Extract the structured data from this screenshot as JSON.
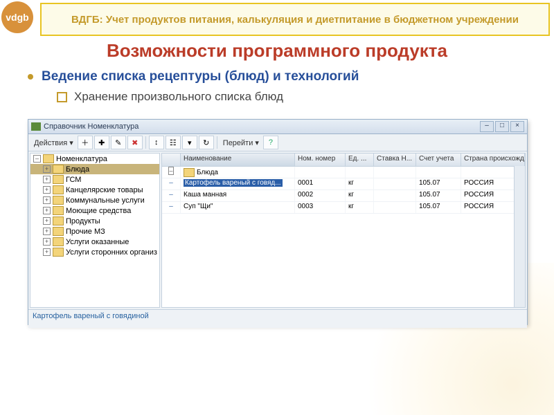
{
  "logo": "vdgb",
  "header": "ВДГБ: Учет продуктов питания, калькуляция и диетпитание в бюджетном учреждении",
  "title": "Возможности программного продукта",
  "bullet1": "Ведение списка рецептуры (блюд) и технологий",
  "bullet2": "Хранение произвольного списка блюд",
  "window": {
    "title": "Справочник Номенклатура",
    "actions": "Действия ▾",
    "goto": "Перейти ▾",
    "tree": {
      "root": "Номенклатура",
      "items": [
        "Блюда",
        "ГСМ",
        "Канцелярские товары",
        "Коммунальные услуги",
        "Моющие средства",
        "Продукты",
        "Прочие МЗ",
        "Услуги оказанные",
        "Услуги сторонних организ"
      ]
    },
    "columns": [
      "",
      "Наименование",
      "Ном. номер",
      "Ед. ...",
      "Ставка Н...",
      "Счет учета",
      "Страна происхождения"
    ],
    "rows": [
      {
        "folder": true,
        "name": "Блюда"
      },
      {
        "name": "Картофель вареный с говяд...",
        "num": "0001",
        "unit": "кг",
        "acct": "105.07",
        "country": "РОССИЯ",
        "selected": true
      },
      {
        "name": "Каша манная",
        "num": "0002",
        "unit": "кг",
        "acct": "105.07",
        "country": "РОССИЯ"
      },
      {
        "name": "Суп \"Щи\"",
        "num": "0003",
        "unit": "кг",
        "acct": "105.07",
        "country": "РОССИЯ"
      }
    ],
    "status": "Картофель вареный с говядиной"
  },
  "icons": {
    "add": "＋",
    "addf": "✚",
    "edit": "✎",
    "del": "✖",
    "sort": "↕",
    "find": "🔍",
    "tree": "☷",
    "help": "?"
  }
}
